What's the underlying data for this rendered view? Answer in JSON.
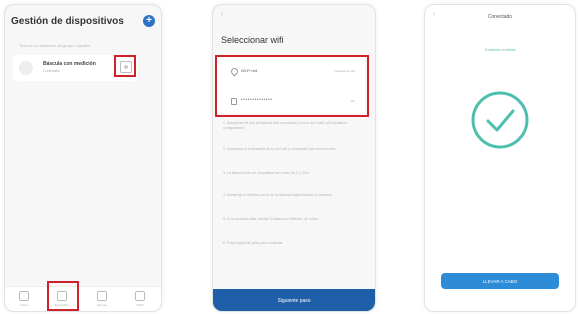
{
  "screen1": {
    "title": "Gestión de dispositivos",
    "add_icon_text": "+",
    "subtitle": "Toca en un elemento de grupo o ajustes",
    "device": {
      "name": "Báscula con medición",
      "status": "Conectado"
    },
    "nav": [
      {
        "label": "Inicio",
        "icon": "home-icon"
      },
      {
        "label": "Dispositivo",
        "icon": "device-icon"
      },
      {
        "label": "Informe",
        "icon": "report-icon"
      },
      {
        "label": "Perfil",
        "icon": "profile-icon"
      }
    ],
    "highlight_color": "#d0202a"
  },
  "screen2": {
    "back": "‹",
    "title": "Seleccionar wifi",
    "wifi": {
      "ssid": "Wi-Fi red",
      "change_label": "Cambiar de red",
      "password_mask": "••••••••••••••",
      "show_label": "Ver"
    },
    "instructions": [
      "1. Asegúrese de que la báscula esté encendida y cerca del router wifi durante la configuración.",
      "2. Introduzca la contraseña de su red wifi y compruebe que sea correcta.",
      "3. La báscula solo es compatible con redes de 2,4 GHz.",
      "4. Mantenga el teléfono cerca de la báscula hasta finalizar la conexión.",
      "5. Si la conexión falla, reinicie la báscula e inténtelo de nuevo.",
      "6. Pulse siguiente paso para continuar."
    ],
    "next_label": "Siguiente paso",
    "accent": "#1f5ea8"
  },
  "screen3": {
    "back": "‹",
    "title": "Conectado",
    "subtitle": "Conexión exitosa",
    "success_icon": "check-circle-icon",
    "finish_label": "LLEVAR A CABO",
    "accent": "#2e8bd6",
    "check_color": "#4cbfae"
  }
}
